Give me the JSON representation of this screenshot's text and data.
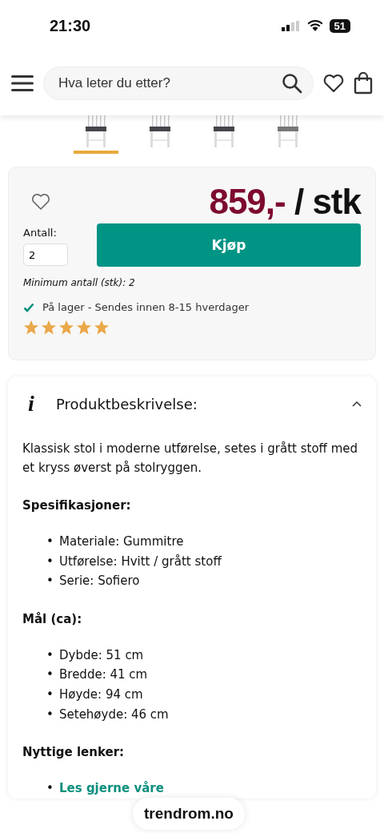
{
  "status_bar": {
    "time": "21:30",
    "battery": "51"
  },
  "header": {
    "search": {
      "placeholder": "Hva leter du etter?"
    }
  },
  "thumbnails": [
    {
      "selected": true
    },
    {
      "selected": false
    },
    {
      "selected": false
    },
    {
      "selected": false
    }
  ],
  "purchase": {
    "price": "859,-",
    "unit": "/ stk",
    "quantity_label": "Antall:",
    "quantity": "2",
    "buy_button": "Kjøp",
    "minimum": "Minimum antall (stk): 2",
    "stock": "På lager - Sendes innen 8-15 hverdager",
    "stars": 5
  },
  "description": {
    "icon": "i",
    "title": "Produktbeskrivelse:",
    "expanded": true,
    "intro": "Klassisk stol i moderne utførelse, setes i grått stoff med et kryss øverst på stolryggen.",
    "bullet": "•",
    "sections": [
      {
        "heading": "Spesifikasjoner:",
        "items": [
          {
            "text": "Materiale: Gummitre",
            "kind": "text"
          },
          {
            "text": "Utførelse: Hvitt / grått stoff",
            "kind": "text"
          },
          {
            "text": "Serie: Sofiero",
            "kind": "text"
          }
        ]
      },
      {
        "heading": "Mål (ca):",
        "items": [
          {
            "text": "Dybde: 51 cm",
            "kind": "text"
          },
          {
            "text": "Bredde: 41 cm",
            "kind": "text"
          },
          {
            "text": "Høyde: 94 cm",
            "kind": "text"
          },
          {
            "text": "Setehøyde: 46 cm",
            "kind": "text"
          }
        ]
      },
      {
        "heading": "Nyttige lenker:",
        "items": [
          {
            "text": "Les gjerne våre",
            "kind": "link"
          }
        ]
      }
    ]
  },
  "url_pill": "trendrom.no"
}
